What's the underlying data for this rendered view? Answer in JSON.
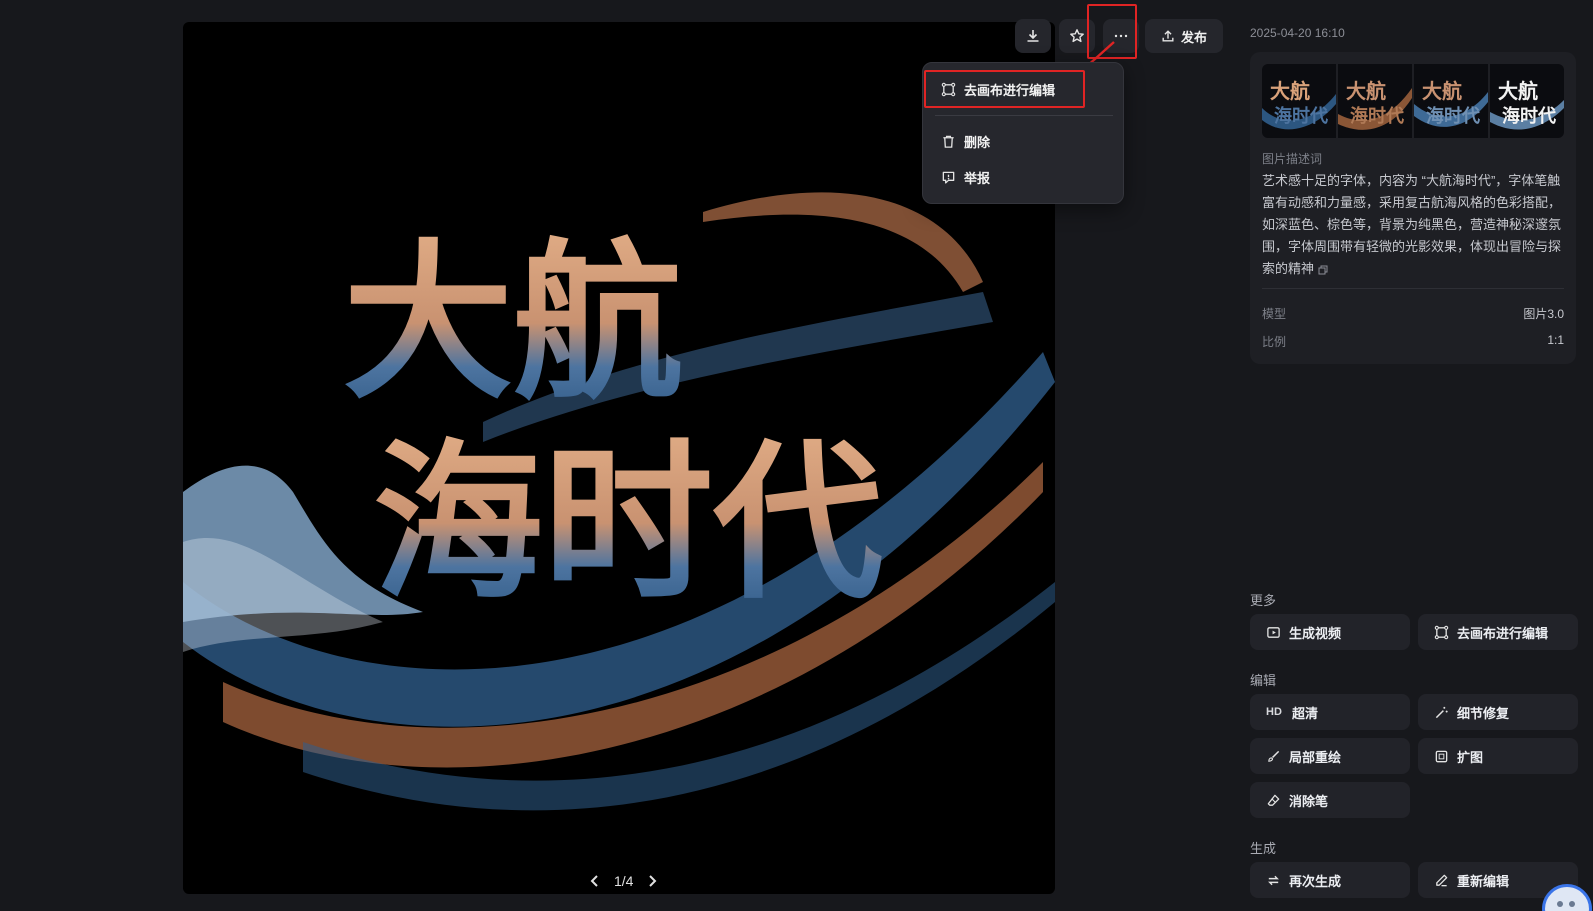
{
  "toolbar": {
    "download_icon": "download-icon",
    "favorite_icon": "star-icon",
    "more_icon": "more-horizontal-icon",
    "publish_label": "发布"
  },
  "more_menu": {
    "items": [
      {
        "label": "去画布进行编辑",
        "icon": "canvas-edit-icon"
      },
      {
        "label": "删除",
        "icon": "trash-icon"
      },
      {
        "label": "举报",
        "icon": "report-icon"
      }
    ]
  },
  "image": {
    "artwork_title": "大航海时代",
    "artwork_line1": "大航",
    "artwork_line2": "海时代",
    "colors": {
      "gold": "#d9a27a",
      "blue": "#3e6a96",
      "wave": "#7fa2c4",
      "background": "#000000"
    }
  },
  "pager": {
    "label": "1/4"
  },
  "sidebar": {
    "timestamp": "2025-04-20 16:10",
    "prompt_label": "图片描述词",
    "prompt_text": "艺术感十足的字体，内容为 “大航海时代”，字体笔触富有动感和力量感，采用复古航海风格的色彩搭配，如深蓝色、棕色等，背景为纯黑色，营造神秘深邃氛围，字体周围带有轻微的光影效果，体现出冒险与探索的精神",
    "meta": [
      {
        "key": "模型",
        "value": "图片3.0"
      },
      {
        "key": "比例",
        "value": "1:1"
      }
    ],
    "more_section": {
      "title": "更多",
      "buttons": [
        {
          "label": "生成视频",
          "icon": "video-icon"
        },
        {
          "label": "去画布进行编辑",
          "icon": "canvas-edit-icon"
        }
      ]
    },
    "edit_section": {
      "title": "编辑",
      "buttons": [
        {
          "label": "超清",
          "badge": "HD"
        },
        {
          "label": "细节修复",
          "icon": "magic-wand-icon"
        },
        {
          "label": "局部重绘",
          "icon": "brush-icon"
        },
        {
          "label": "扩图",
          "icon": "expand-icon"
        },
        {
          "label": "消除笔",
          "icon": "eraser-icon"
        }
      ]
    },
    "generate_section": {
      "title": "生成",
      "buttons": [
        {
          "label": "再次生成",
          "icon": "regenerate-icon"
        },
        {
          "label": "重新编辑",
          "icon": "pencil-icon"
        }
      ]
    }
  }
}
